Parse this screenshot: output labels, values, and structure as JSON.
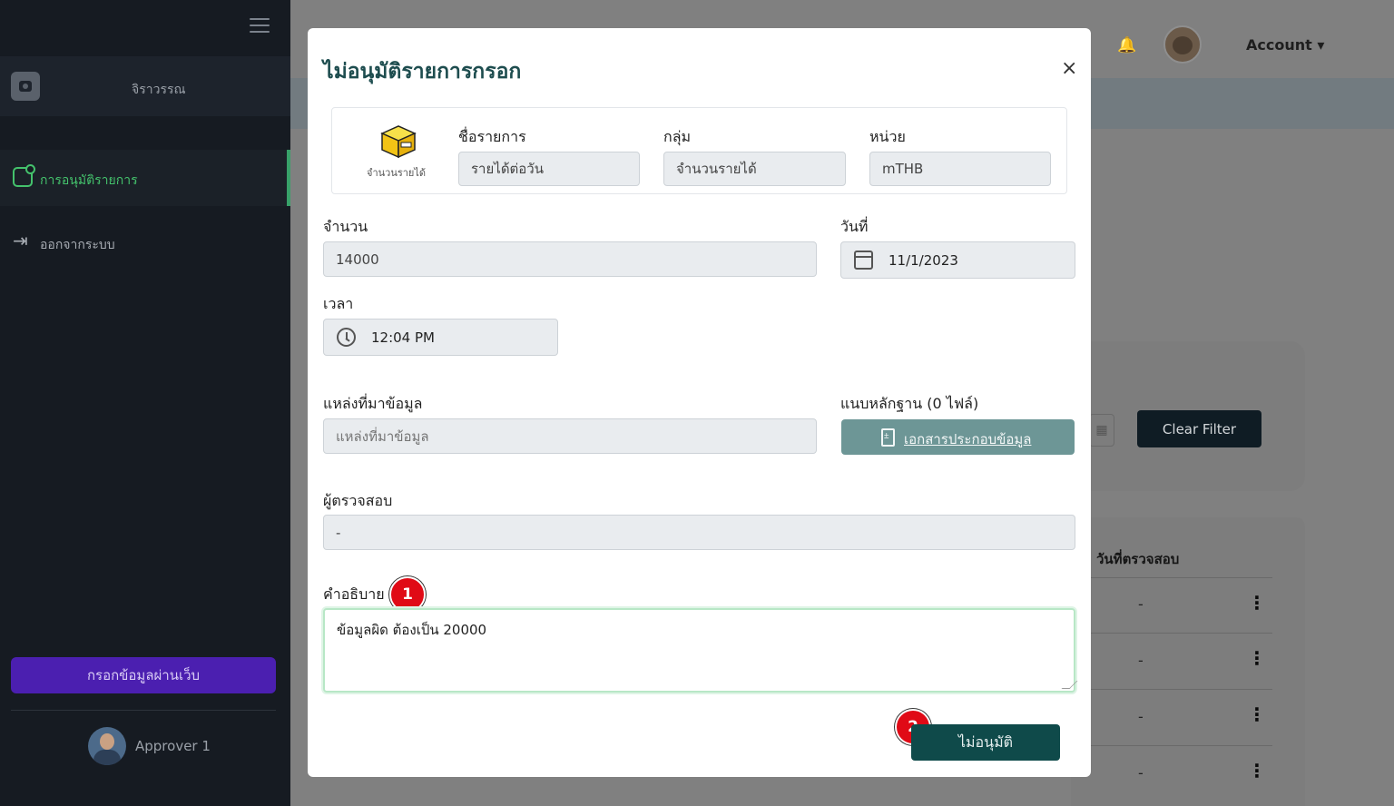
{
  "sidebar": {
    "org_name": "จิราวรรณ",
    "items": [
      {
        "label": "การอนุมัติรายการ",
        "icon": "approval-icon",
        "active": true
      },
      {
        "label": "ออกจากระบบ",
        "icon": "logout-icon",
        "active": false
      }
    ],
    "web_entry_label": "กรอกข้อมูลผ่านเว็บ",
    "user_name": "Approver 1"
  },
  "topbar": {
    "account_label": "Account ▾",
    "bell_icon": "bell-icon"
  },
  "background": {
    "clear_filter_label": "Clear Filter",
    "table_header": "วันที่ตรวจสอบ",
    "row_values": [
      "-",
      "-",
      "-",
      "-"
    ],
    "row_menu_glyph": "⋮"
  },
  "modal": {
    "title": "ไม่อนุมัติรายการกรอก",
    "close_label": "×",
    "item": {
      "icon_caption": "จำนวนรายได้",
      "name_label": "ชื่อรายการ",
      "name_value": "รายได้ต่อวัน",
      "group_label": "กลุ่ม",
      "group_value": "จำนวนรายได้",
      "unit_label": "หน่วย",
      "unit_value": "mTHB"
    },
    "amount_label": "จำนวน",
    "amount_value": "14000",
    "date_label": "วันที่",
    "date_value": "11/1/2023",
    "time_label": "เวลา",
    "time_value": "12:04 PM",
    "source_label": "แหล่งที่มาข้อมูล",
    "source_placeholder": "แหล่งที่มาข้อมูล",
    "evidence_label": "แนบหลักฐาน (0 ไฟล์)",
    "evidence_button": "เอกสารประกอบข้อมูล",
    "reviewer_label": "ผู้ตรวจสอบ",
    "reviewer_value": "-",
    "description_label": "คำอธิบาย",
    "description_value": "ข้อมูลผิด ต้องเป็น 20000",
    "reject_button": "ไม่อนุมัติ"
  },
  "annotations": {
    "step1": "1",
    "step2": "2",
    "badge_color": "#e00a16"
  },
  "colors": {
    "sidebar_bg": "#161b22",
    "accent_green": "#44c26c",
    "primary_teal": "#0f4a4a",
    "purple_button": "#4b1fb0"
  }
}
